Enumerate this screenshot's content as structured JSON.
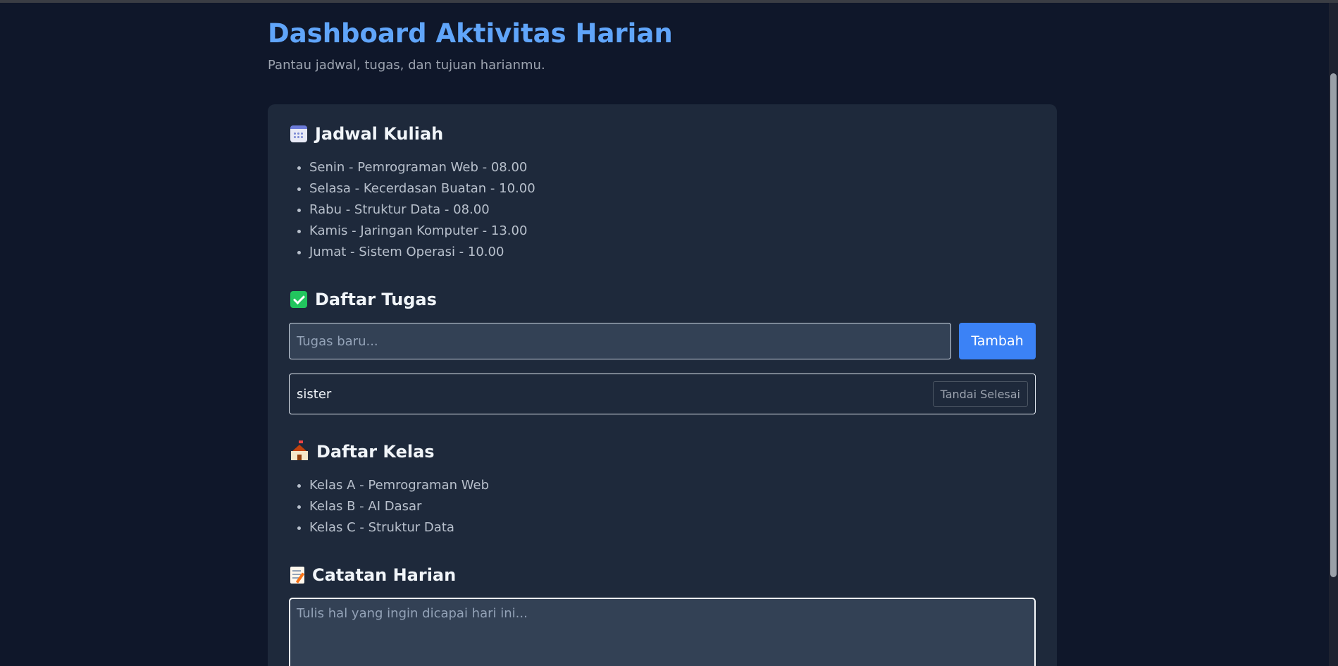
{
  "header": {
    "title": "Dashboard Aktivitas Harian",
    "subtitle": "Pantau jadwal, tugas, dan tujuan harianmu."
  },
  "schedule": {
    "heading": "Jadwal Kuliah",
    "icon": "calendar-icon",
    "items": [
      "Senin - Pemrograman Web - 08.00",
      "Selasa - Kecerdasan Buatan - 10.00",
      "Rabu - Struktur Data - 08.00",
      "Kamis - Jaringan Komputer - 13.00",
      "Jumat - Sistem Operasi - 10.00"
    ]
  },
  "tasks": {
    "heading": "Daftar Tugas",
    "icon": "check-icon",
    "input_placeholder": "Tugas baru...",
    "add_label": "Tambah",
    "items": [
      {
        "text": "sister",
        "action_label": "Tandai Selesai"
      }
    ]
  },
  "classes": {
    "heading": "Daftar Kelas",
    "icon": "school-icon",
    "items": [
      "Kelas A - Pemrograman Web",
      "Kelas B - AI Dasar",
      "Kelas C - Struktur Data"
    ]
  },
  "notes": {
    "heading": "Catatan Harian",
    "icon": "memo-icon",
    "placeholder": "Tulis hal yang ingin dicapai hari ini..."
  },
  "colors": {
    "background": "#0f172a",
    "card": "#1e293b",
    "accent": "#60a5fa",
    "button": "#3b82f6"
  }
}
